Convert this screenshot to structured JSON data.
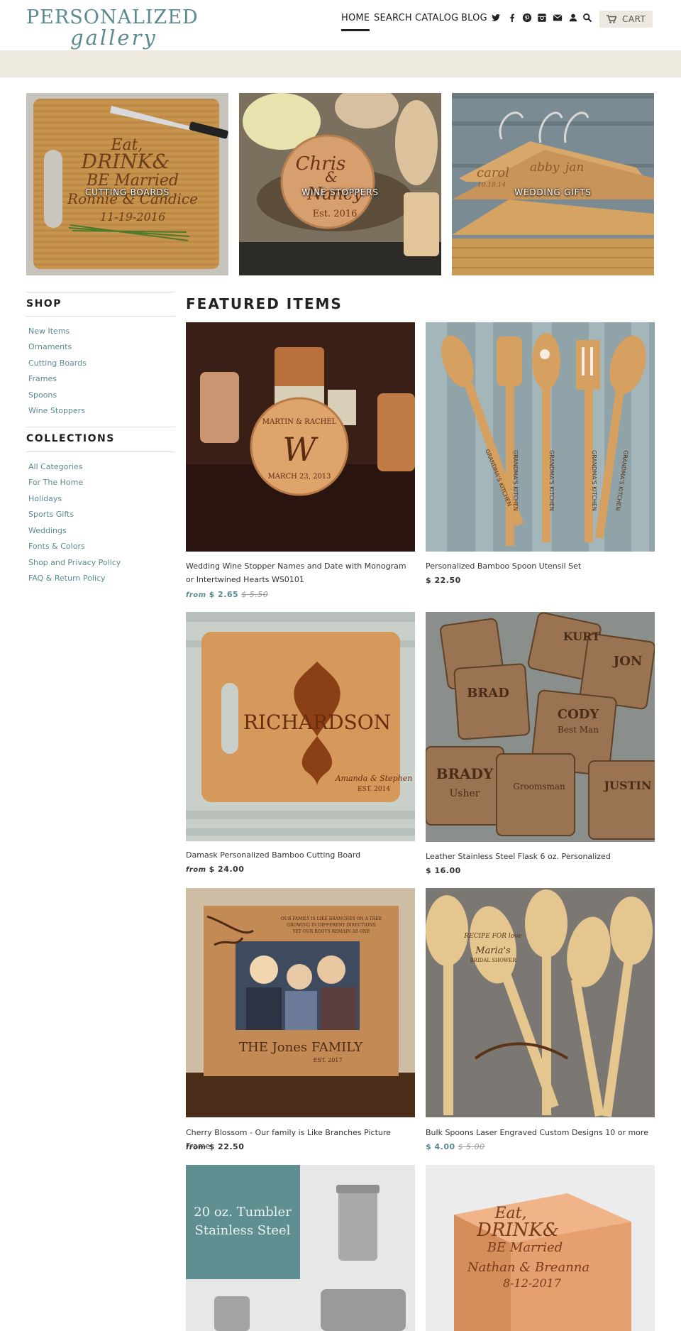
{
  "header": {
    "logo_top": "PERSONALIZED",
    "logo_bottom": "gallery",
    "nav": [
      "HOME",
      "SEARCH",
      "CATALOG",
      "BLOG"
    ],
    "social_icons": [
      "twitter-icon",
      "facebook-icon",
      "pinterest-icon",
      "instagram-icon",
      "email-icon",
      "account-icon",
      "search-icon"
    ],
    "cart_label": "CART"
  },
  "banners": [
    {
      "label": "CUTTING BOARDS",
      "engraving": [
        "Eat,",
        "DRINK&",
        "BE Married",
        "Ronnie & Candice",
        "11-19-2016"
      ]
    },
    {
      "label": "WINE STOPPERS",
      "engraving": [
        "Chris",
        "&",
        "Nancy",
        "Est. 2016"
      ]
    },
    {
      "label": "WEDDING GIFTS",
      "engraving": [
        "carol",
        "abby",
        "jan",
        "10.18.14"
      ]
    }
  ],
  "sidebar": {
    "shop_heading": "SHOP",
    "shop_items": [
      "New Items",
      "Ornaments",
      "Cutting Boards",
      "Frames",
      "Spoons",
      "Wine Stoppers"
    ],
    "collections_heading": "COLLECTIONS",
    "collection_items": [
      "All Categories",
      "For The Home",
      "Holidays",
      "Sports Gifts",
      "Weddings",
      "Fonts & Colors",
      "Shop and Privacy Policy",
      "FAQ & Return Policy"
    ]
  },
  "featured": {
    "title": "FEATURED ITEMS",
    "products": [
      {
        "title": "Wedding Wine Stopper Names and Date with Monogram or Intertwined Hearts WS0101",
        "from": "from",
        "price": "$ 2.65",
        "compare": "$ 5.50",
        "engraving": [
          "MARTIN & RACHEL",
          "W",
          "MARCH 23, 2013"
        ]
      },
      {
        "title": "Personalized Bamboo Spoon Utensil Set",
        "from": "",
        "price": "$ 22.50",
        "compare": "",
        "engraving": [
          "GRANDMA'S KITCHEN"
        ]
      },
      {
        "title": "Damask Personalized Bamboo Cutting Board",
        "from": "from",
        "price": "$ 24.00",
        "compare": "",
        "engraving": [
          "RICHARDSON",
          "Amanda & Stephen",
          "EST. 2014"
        ]
      },
      {
        "title": "Leather Stainless Steel Flask 6 oz. Personalized",
        "from": "",
        "price": "$ 16.00",
        "compare": "",
        "engraving": [
          "KURT",
          "JON",
          "BRAD",
          "CODY",
          "BRADY",
          "JUSTIN",
          "Groomsman",
          "Best Man",
          "Usher"
        ]
      },
      {
        "title": "Cherry Blossom - Our family is Like Branches Picture Frame",
        "from": "from",
        "price": "$ 22.50",
        "compare": "",
        "engraving": [
          "THE Jones FAMILY",
          "EST. 2017",
          "OUR FAMILY IS LIKE BRANCHES ON A TREE",
          "GROWING IN DIFFERENT DIRECTIONS",
          "YET OUR ROOTS REMAIN AS ONE"
        ]
      },
      {
        "title": "Bulk Spoons Laser Engraved Custom Designs 10 or more",
        "from": "",
        "price": "$ 4.00",
        "compare": "$ 5.00",
        "engraving": [
          "RECIPE FOR love",
          "Maria's",
          "BRIDAL SHOWER"
        ]
      },
      {
        "title": "",
        "from": "",
        "price": "",
        "compare": "",
        "engraving": [
          "20 oz. Tumbler",
          "Stainless Steel"
        ]
      },
      {
        "title": "",
        "from": "",
        "price": "",
        "compare": "",
        "engraving": [
          "Eat,",
          "DRINK&",
          "BE Married",
          "Nathan & Breanna",
          "8-12-2017"
        ]
      }
    ]
  },
  "colors": {
    "accent": "#5b8a8f",
    "band": "#ede9de",
    "cart_bg": "#ede9e0",
    "text": "#222222"
  }
}
